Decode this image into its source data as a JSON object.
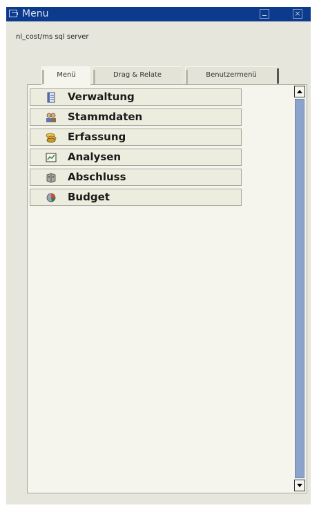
{
  "window": {
    "title": "Menu",
    "close_glyph": "×",
    "subtitle": "nl_cost/ms sql server",
    "title_color": "#0c3a8c"
  },
  "tabs": [
    {
      "label": "Menü",
      "active": true
    },
    {
      "label": "Drag & Relate",
      "active": false
    },
    {
      "label": "Benutzermenü",
      "active": false
    }
  ],
  "menu": {
    "items": [
      {
        "label": "Verwaltung",
        "icon": "document-icon"
      },
      {
        "label": "Stammdaten",
        "icon": "people-icon"
      },
      {
        "label": "Erfassung",
        "icon": "coins-icon"
      },
      {
        "label": "Analysen",
        "icon": "chart-icon"
      },
      {
        "label": "Abschluss",
        "icon": "cabinet-icon"
      },
      {
        "label": "Budget",
        "icon": "budget-icon"
      }
    ]
  }
}
